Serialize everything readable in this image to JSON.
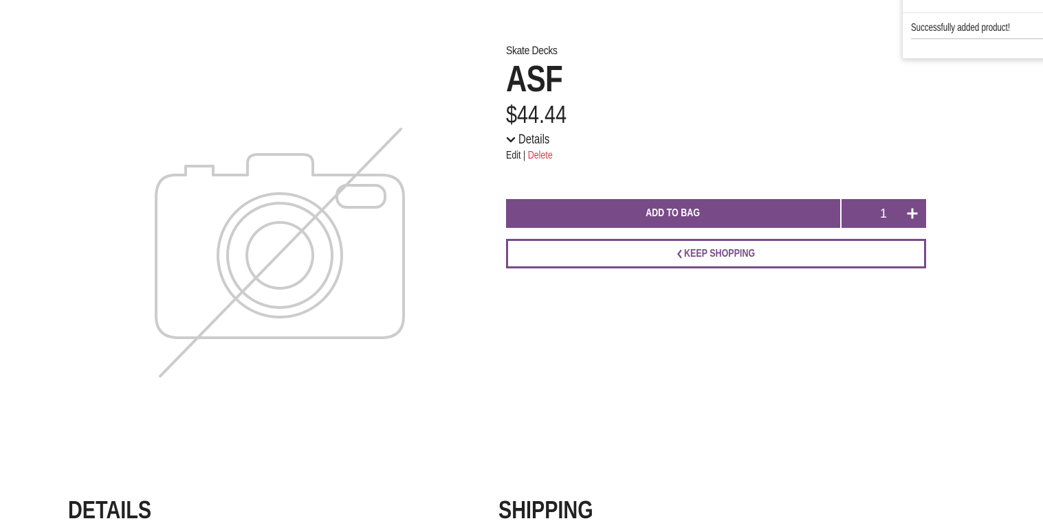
{
  "product": {
    "category": "Skate Decks",
    "name": "ASF",
    "price": "$44.44",
    "details_toggle_label": "Details",
    "image_icon": "no-image-camera-icon"
  },
  "admin": {
    "edit_label": "Edit",
    "separator": "|",
    "delete_label": "Delete"
  },
  "cart": {
    "add_to_bag_label": "Add to Bag",
    "quantity": "1",
    "increment_icon": "plus-icon",
    "keep_shopping_label": "Keep Shopping",
    "keep_shopping_icon": "chevron-left-icon"
  },
  "toast": {
    "message": "Successfully added product!"
  },
  "sections": {
    "details_heading": "Details",
    "shipping_heading": "Shipping"
  },
  "colors": {
    "accent": "#784b88",
    "danger": "#dc3545",
    "text": "#222222",
    "placeholder_gray": "#cccccc"
  }
}
